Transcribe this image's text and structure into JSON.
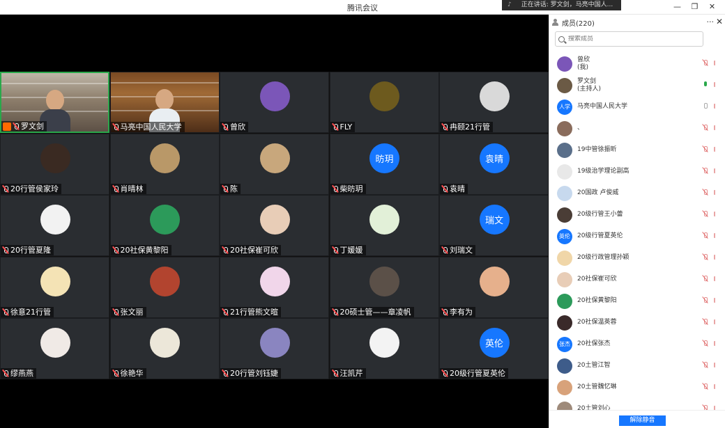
{
  "window": {
    "title": "腾讯会议",
    "speaking_banner": "正在讲话: 罗文剑，马亮中国人...",
    "controls": [
      "—",
      "❐",
      "✕"
    ]
  },
  "video_grid": [
    {
      "name": "罗文剑",
      "kind": "camera",
      "host": true
    },
    {
      "name": "马亮中国人民大学",
      "kind": "camera"
    },
    {
      "name": "曾欣",
      "kind": "image",
      "color": "#7b56b8"
    },
    {
      "name": "FLY",
      "kind": "image",
      "color": "#6d5a1e"
    },
    {
      "name": "冉颐21行管",
      "kind": "image",
      "color": "#d9d9d9"
    },
    {
      "name": "20行管侯家玲",
      "kind": "image",
      "color": "#3a2a22"
    },
    {
      "name": "肖晴林",
      "kind": "image",
      "color": "#b99868"
    },
    {
      "name": "陈",
      "kind": "image",
      "color": "#c8a77c"
    },
    {
      "name": "柴昉玥",
      "kind": "text",
      "avatar_text": "昉玥"
    },
    {
      "name": "袁晴",
      "kind": "text",
      "avatar_text": "袁晴"
    },
    {
      "name": "20行管夏隆",
      "kind": "image",
      "color": "#f2f2f2"
    },
    {
      "name": "20社保黄黎阳",
      "kind": "image",
      "color": "#2c9a5a"
    },
    {
      "name": "20社保崔可欣",
      "kind": "image",
      "color": "#e8cdb7"
    },
    {
      "name": "丁媛媛",
      "kind": "image",
      "color": "#e2f0d8"
    },
    {
      "name": "刘瑞文",
      "kind": "text",
      "avatar_text": "瑞文"
    },
    {
      "name": "徐意21行管",
      "kind": "image",
      "color": "#f4e3b5"
    },
    {
      "name": "张文丽",
      "kind": "image",
      "color": "#b2442f"
    },
    {
      "name": "21行管熊文暄",
      "kind": "image",
      "color": "#f1d6ea"
    },
    {
      "name": "20硕士管——章凌帆",
      "kind": "image",
      "color": "#5b5048"
    },
    {
      "name": "李有为",
      "kind": "image",
      "color": "#e6b08c"
    },
    {
      "name": "缪燕燕",
      "kind": "image",
      "color": "#f0eae6"
    },
    {
      "name": "徐艳华",
      "kind": "image",
      "color": "#ece7d9"
    },
    {
      "name": "20行管刘钰婕",
      "kind": "image",
      "color": "#8a85c0"
    },
    {
      "name": "汪凯芹",
      "kind": "image",
      "color": "#f3f3f3"
    },
    {
      "name": "20级行管夏英伦",
      "kind": "text",
      "avatar_text": "英伦"
    }
  ],
  "members_panel": {
    "title": "成员(220)",
    "more": "···",
    "close": "✕",
    "search_placeholder": "搜索成员",
    "members": [
      {
        "name": "曾欣",
        "sub": "(我)",
        "avatar_color": "#7b56b8",
        "mic": "muted"
      },
      {
        "name": "罗文剑",
        "sub": "(主持人)",
        "avatar_color": "#6b5a45",
        "mic": "live"
      },
      {
        "name": "马亮中国人民大学",
        "avatar_text": "人学",
        "avatar_color": "#1677ff",
        "mic": "idle"
      },
      {
        "name": "、",
        "avatar_color": "#8a6c5c",
        "mic": "muted"
      },
      {
        "name": "19中管徐振昕",
        "avatar_color": "#5a6f8a",
        "mic": "muted"
      },
      {
        "name": "19级治学理论副高",
        "avatar_color": "#e8e8e8",
        "mic": "muted"
      },
      {
        "name": "20国政 卢俊威",
        "avatar_color": "#c7d9ee",
        "mic": "muted"
      },
      {
        "name": "20级行管王小蕾",
        "avatar_color": "#4a3d36",
        "mic": "muted"
      },
      {
        "name": "20级行管夏英伦",
        "avatar_text": "英伦",
        "avatar_color": "#1677ff",
        "mic": "muted"
      },
      {
        "name": "20级行政管理孙颖",
        "avatar_color": "#f0d6a8",
        "mic": "muted"
      },
      {
        "name": "20社保崔可欣",
        "avatar_color": "#e8cdb7",
        "mic": "muted"
      },
      {
        "name": "20社保黄黎阳",
        "avatar_color": "#2c9a5a",
        "mic": "muted"
      },
      {
        "name": "20社保温英蓉",
        "avatar_color": "#3a2a2a",
        "mic": "muted"
      },
      {
        "name": "20社保张杰",
        "avatar_text": "张杰",
        "avatar_color": "#1677ff",
        "mic": "muted"
      },
      {
        "name": "20土管江智",
        "avatar_color": "#3e5c8a",
        "mic": "muted"
      },
      {
        "name": "20土管魏忆琳",
        "avatar_color": "#d8a27a",
        "mic": "muted"
      },
      {
        "name": "20土管刘心",
        "avatar_color": "#9e8a7a",
        "mic": "muted"
      }
    ],
    "footer_button": "解除静音"
  }
}
